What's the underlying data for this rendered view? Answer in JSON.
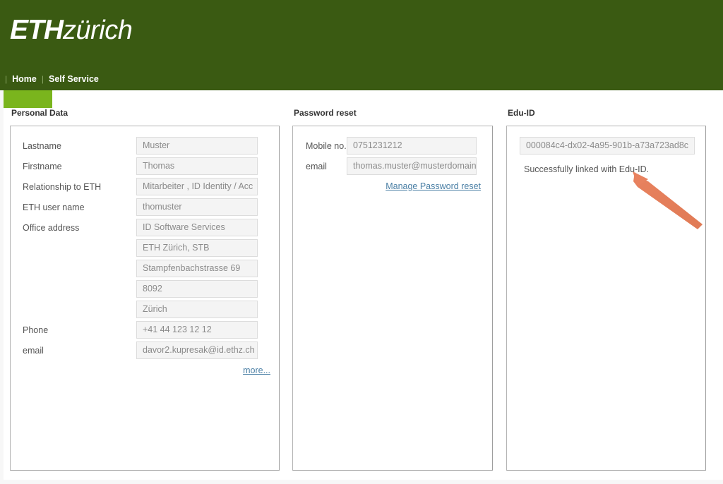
{
  "header": {
    "logo_eth": "ETH",
    "logo_zurich": "zürich",
    "nav": [
      {
        "label": "Home"
      },
      {
        "label": "Self Service"
      }
    ],
    "separator": "|"
  },
  "colors": {
    "header_green": "#3a5a12",
    "accent_green": "#7ab51d",
    "link_blue": "#4a7fa5",
    "annotation_arrow": "#e8825f",
    "input_background": "#f4f4f4",
    "input_border": "#dcdcdc"
  },
  "personal_data": {
    "title": "Personal Data",
    "rows": [
      {
        "label": "Lastname",
        "value": "Muster"
      },
      {
        "label": "Firstname",
        "value": "Thomas"
      },
      {
        "label": "Relationship to ETH",
        "value": "Mitarbeiter , ID Identity / Acc"
      },
      {
        "label": "ETH user name",
        "value": "thomuster"
      },
      {
        "label": "Office address",
        "value": "ID Software Services"
      },
      {
        "label": "",
        "value": "ETH Zürich, STB"
      },
      {
        "label": "",
        "value": "Stampfenbachstrasse 69"
      },
      {
        "label": "",
        "value": "8092"
      },
      {
        "label": "",
        "value": "Zürich"
      },
      {
        "label": "Phone",
        "value": "+41 44 123 12 12"
      },
      {
        "label": "email",
        "value": "davor2.kupresak@id.ethz.ch"
      }
    ],
    "more_link": "more..."
  },
  "password_reset": {
    "title": "Password reset",
    "rows": [
      {
        "label": "Mobile no.",
        "value": "0751231212"
      },
      {
        "label": "email",
        "value": "thomas.muster@musterdomain"
      }
    ],
    "manage_link": "Manage Password reset"
  },
  "edu_id": {
    "title": "Edu-ID",
    "identifier": "000084c4-dx02-4a95-901b-a73a723ad8c",
    "status": "Successfully linked with Edu-ID."
  }
}
